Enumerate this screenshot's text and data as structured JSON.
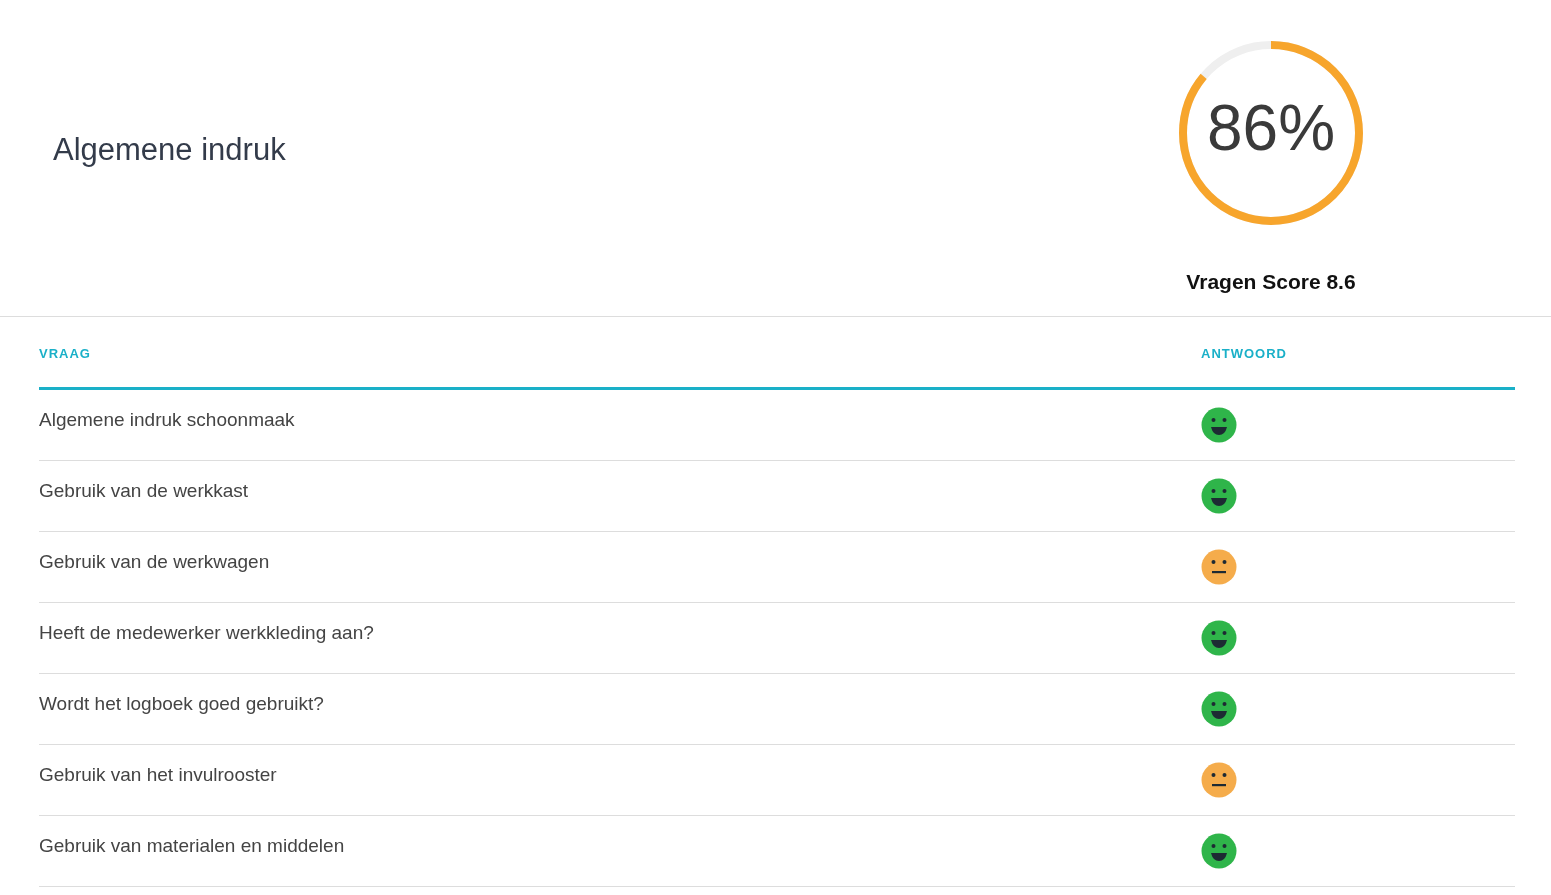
{
  "section": {
    "title": "Algemene indruk"
  },
  "score": {
    "percent": "86%",
    "level": 0.86,
    "caption": "Vragen Score 8.6"
  },
  "table": {
    "columns": [
      "VRAAG",
      "ANTWOORD"
    ],
    "rows": [
      {
        "question": "Algemene indruk schoonmaak",
        "answer": {
          "kind": "happy"
        }
      },
      {
        "question": "Gebruik van de werkkast",
        "answer": {
          "kind": "happy"
        }
      },
      {
        "question": "Gebruik van de werkwagen",
        "answer": {
          "kind": "neutral"
        }
      },
      {
        "question": "Heeft de medewerker werkkleding aan?",
        "answer": {
          "kind": "happy"
        }
      },
      {
        "question": "Wordt het logboek goed gebruikt?",
        "answer": {
          "kind": "happy"
        }
      },
      {
        "question": "Gebruik van het invulrooster",
        "answer": {
          "kind": "neutral"
        }
      },
      {
        "question": "Gebruik van materialen en middelen",
        "answer": {
          "kind": "happy"
        }
      }
    ]
  }
}
